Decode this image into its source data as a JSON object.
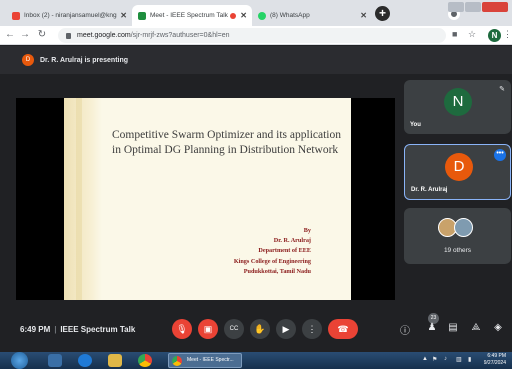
{
  "browser": {
    "tabs": [
      {
        "title": "Inbox (2) - niranjansamuel@kng",
        "color": "#ea4335",
        "active": false
      },
      {
        "title": "Meet - IEEE Spectrum Talk",
        "color": "#1e8e3e",
        "active": true
      },
      {
        "title": "(8) WhatsApp",
        "color": "#25d366",
        "active": false
      }
    ],
    "new_tab": "+",
    "url_host": "meet.google.com",
    "url_path": "/sjr-mrjf-zws?authuser=0&hl=en",
    "profile_initial": "N"
  },
  "meet": {
    "presenter_initial": "D",
    "presenting_text": "Dr. R. Arulraj is presenting",
    "slide": {
      "title": "Competitive Swarm Optimizer and its application in Optimal DG Planning in Distribution Network",
      "author_lines": [
        "By",
        "Dr. R. Arulraj",
        "Department of EEE",
        "Kings College of Engineering",
        "Pudukkottai, Tamil Nadu"
      ]
    },
    "tiles": [
      {
        "initial": "N",
        "name": "You",
        "color": "#1e6a3e"
      },
      {
        "initial": "D",
        "name": "Dr. R. Arulraj",
        "color": "#e8590c"
      },
      {
        "name": "19 others"
      }
    ],
    "time": "6:49 PM",
    "meeting_name": "IEEE Spectrum Talk",
    "participants_badge": "23"
  },
  "taskbar": {
    "active_task": "Meet - IEEE Spectr...",
    "clock_time": "6:49 PM",
    "clock_date": "9/27/2024"
  }
}
